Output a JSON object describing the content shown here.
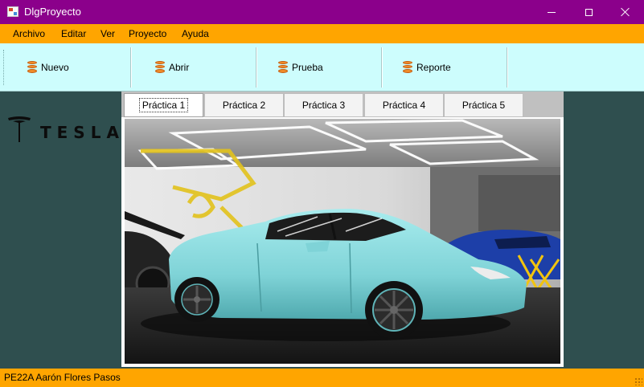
{
  "window": {
    "title": "DlgProyecto",
    "controls": [
      "minimize-icon",
      "maximize-icon",
      "close-icon"
    ]
  },
  "menu": {
    "items": [
      "Archivo",
      "Editar",
      "Ver",
      "Proyecto",
      "Ayuda"
    ]
  },
  "toolbar": {
    "buttons": [
      {
        "label": "Nuevo",
        "icon": "database-icon"
      },
      {
        "label": "Abrir",
        "icon": "database-icon"
      },
      {
        "label": "Prueba",
        "icon": "database-icon"
      },
      {
        "label": "Reporte",
        "icon": "database-icon"
      }
    ]
  },
  "logo": {
    "wordmark": "TESLA",
    "icon": "tesla-logo-icon"
  },
  "tabs": {
    "items": [
      "Práctica 1",
      "Práctica 2",
      "Práctica 3",
      "Práctica 4",
      "Práctica 5"
    ],
    "selected": "Práctica 1"
  },
  "content": {
    "image": "car-photo"
  },
  "status": {
    "text": "PE22A  Aarón Flores Pasos"
  },
  "colors": {
    "title_bar": "#8b008b",
    "menu_bar": "#ffa500",
    "toolbar": "#cdfdfd",
    "left_panel": "#2f4f4f",
    "status_bar": "#ffa500"
  }
}
